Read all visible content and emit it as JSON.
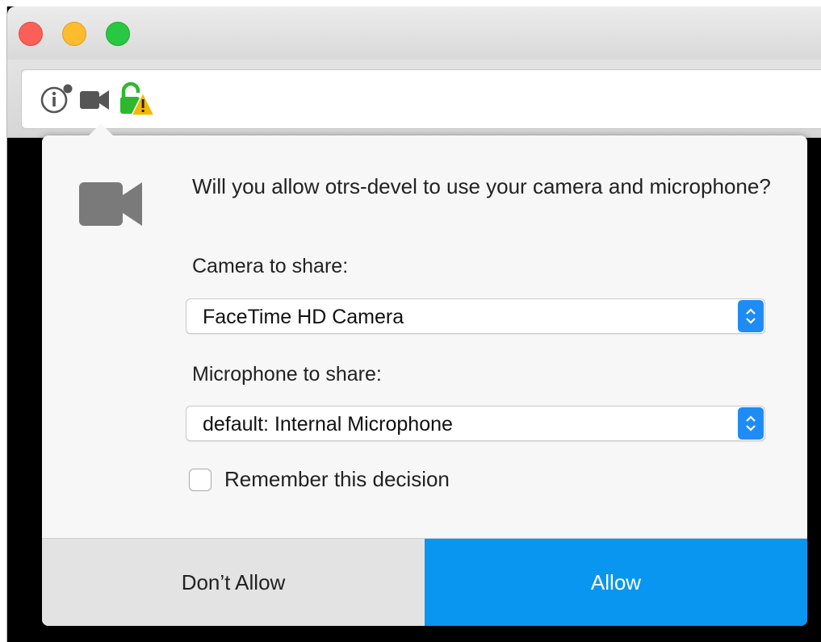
{
  "window": {
    "traffic_lights": [
      "close",
      "minimize",
      "zoom"
    ]
  },
  "url_bar": {
    "icons": [
      "info-icon",
      "camera-icon",
      "lock-warning-icon"
    ]
  },
  "prompt": {
    "question": "Will you allow otrs-devel to use your camera and microphone?",
    "camera_label": "Camera to share:",
    "camera_selected": "FaceTime HD Camera",
    "microphone_label": "Microphone to share:",
    "microphone_selected": "default: Internal Microphone",
    "remember_label": "Remember this decision",
    "remember_checked": false,
    "deny_label": "Don’t Allow",
    "allow_label": "Allow"
  },
  "colors": {
    "accent": "#0896f0",
    "close": "#fc5f57",
    "minimize": "#fdbc2e",
    "zoom": "#28c840",
    "lock_green": "#2eb82e",
    "warning_yellow": "#f5b800"
  }
}
